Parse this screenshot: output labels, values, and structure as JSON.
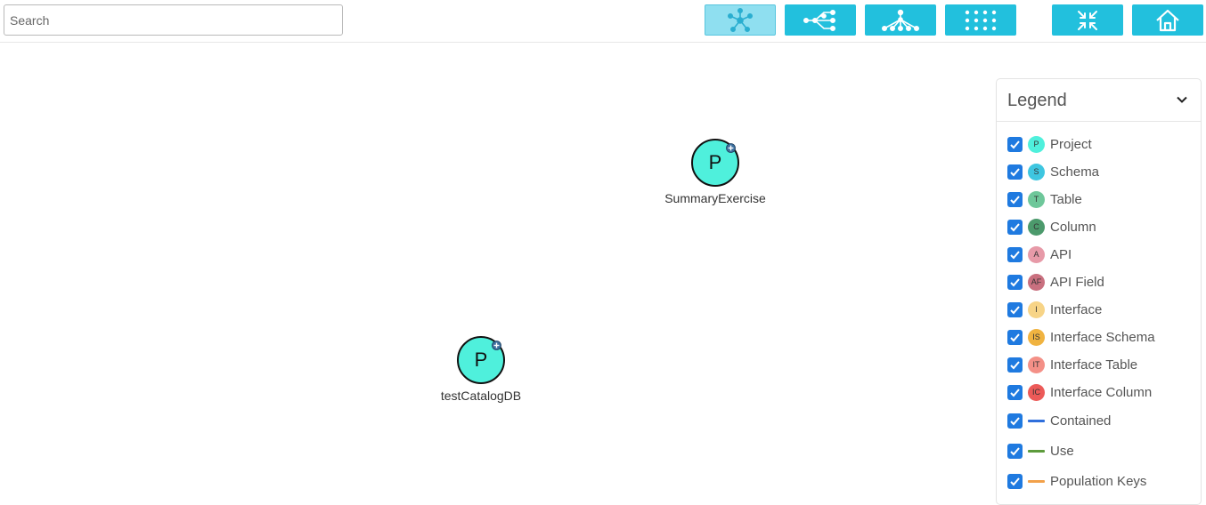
{
  "search": {
    "placeholder": "Search",
    "value": ""
  },
  "toolbar": {
    "buttons": [
      {
        "name": "star-layout-button",
        "icon": "star-network-icon",
        "active": true
      },
      {
        "name": "tree-horizontal-layout-button",
        "icon": "horizontal-tree-icon",
        "active": false
      },
      {
        "name": "tree-vertical-layout-button",
        "icon": "vertical-tree-icon",
        "active": false
      },
      {
        "name": "grid-layout-button",
        "icon": "grid-dots-icon",
        "active": false
      },
      {
        "name": "collapse-button",
        "icon": "collapse-arrows-icon",
        "active": false
      },
      {
        "name": "home-button",
        "icon": "home-icon",
        "active": false
      }
    ],
    "colors": {
      "button": "#22c0dd",
      "active": "#8fdff0"
    }
  },
  "graph": {
    "nodes": [
      {
        "letter": "P",
        "label": "SummaryExercise",
        "color": "#4ff0dc",
        "expand_icon": "plus-circle-icon"
      },
      {
        "letter": "P",
        "label": "testCatalogDB",
        "color": "#4ff0dc",
        "expand_icon": "plus-circle-icon"
      }
    ]
  },
  "legend": {
    "title": "Legend",
    "toggle_icon": "chevron-down-icon",
    "items": [
      {
        "badge": "P",
        "label": "Project",
        "color": "#4ff0dc",
        "checked": true
      },
      {
        "badge": "S",
        "label": "Schema",
        "color": "#3ec6e0",
        "checked": true
      },
      {
        "badge": "T",
        "label": "Table",
        "color": "#6ec79a",
        "checked": true
      },
      {
        "badge": "C",
        "label": "Column",
        "color": "#4c9a6c",
        "checked": true
      },
      {
        "badge": "A",
        "label": "API",
        "color": "#e79aa8",
        "checked": true
      },
      {
        "badge": "AF",
        "label": "API Field",
        "color": "#c9707f",
        "checked": true
      },
      {
        "badge": "I",
        "label": "Interface",
        "color": "#f7d487",
        "checked": true
      },
      {
        "badge": "IS",
        "label": "Interface Schema",
        "color": "#f0b340",
        "checked": true
      },
      {
        "badge": "IT",
        "label": "Interface Table",
        "color": "#f49087",
        "checked": true
      },
      {
        "badge": "IC",
        "label": "Interface Column",
        "color": "#ec5a58",
        "checked": true
      },
      {
        "line": true,
        "label": "Contained",
        "color": "#2f6fdc",
        "checked": true
      },
      {
        "line": true,
        "label": "Use",
        "color": "#5d9b3c",
        "checked": true
      },
      {
        "line": true,
        "label": "Population Keys",
        "color": "#f2a14a",
        "checked": true
      }
    ]
  }
}
